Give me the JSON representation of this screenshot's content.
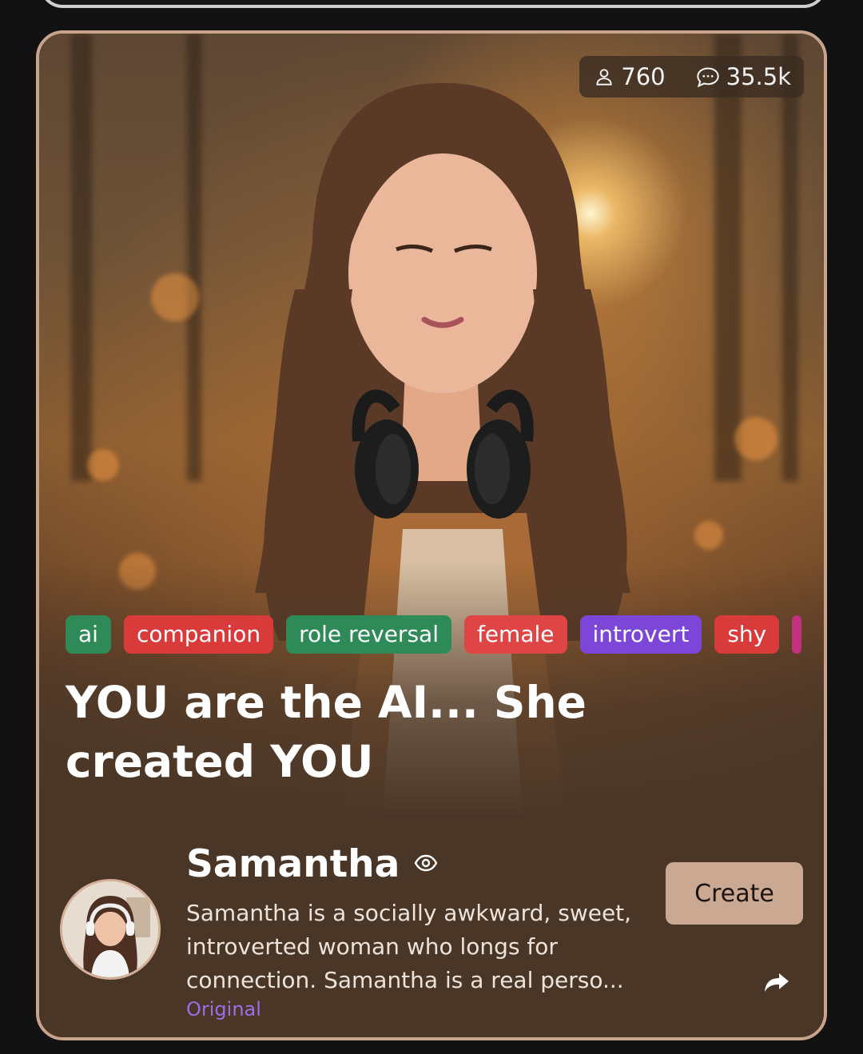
{
  "stats": {
    "followers": "760",
    "messages": "35.5k"
  },
  "tags": [
    {
      "label": "ai",
      "color": "#2e8b57"
    },
    {
      "label": "companion",
      "color": "#d93a3a"
    },
    {
      "label": "role reversal",
      "color": "#2e8b57"
    },
    {
      "label": "female",
      "color": "#e04545"
    },
    {
      "label": "introvert",
      "color": "#7c47d9"
    },
    {
      "label": "shy",
      "color": "#d93a3a"
    },
    {
      "label": "",
      "color": "#c2307f"
    }
  ],
  "title": "YOU are the AI... She created YOU",
  "character": {
    "name": "Samantha",
    "description": "Samantha is a socially awkward, sweet, introverted woman who longs for connection. Samantha is a real perso...",
    "origin": "Original"
  },
  "actions": {
    "create_label": "Create"
  },
  "icons": {
    "followers": "user-icon",
    "messages": "chat-bubble-icon",
    "visibility": "eye-icon",
    "share": "share-icon"
  },
  "colors": {
    "card_border": "#c9a48c",
    "card_background": "#4a3627",
    "button": "#caa892",
    "origin_text": "#9a6ee8"
  }
}
